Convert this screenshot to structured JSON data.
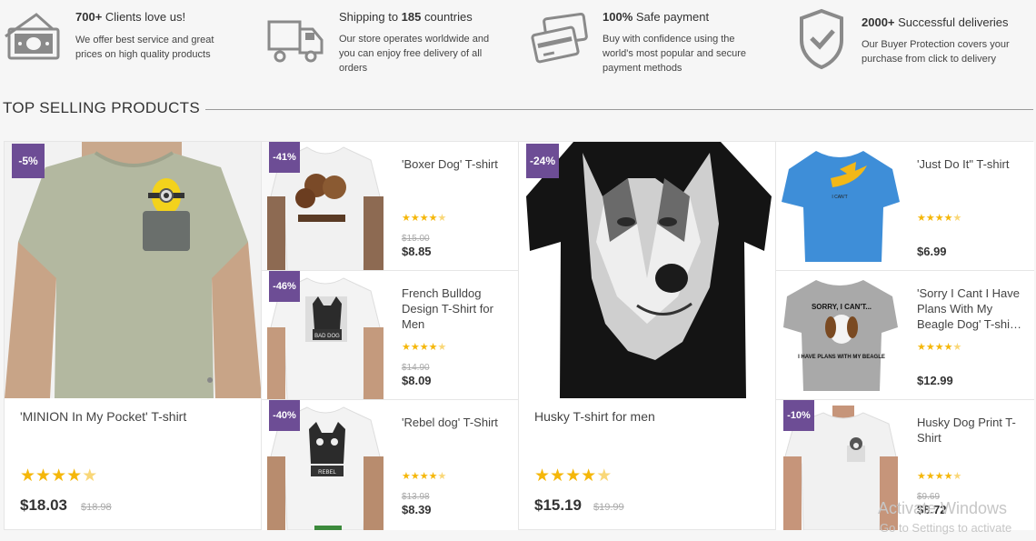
{
  "features": [
    {
      "icon": "money-icon",
      "title_bold": "700+",
      "title_rest": " Clients love us!",
      "desc": "We offer best service and great prices on high quality products"
    },
    {
      "icon": "truck-icon",
      "title_pre": "Shipping to ",
      "title_bold": "185",
      "title_rest": " countries",
      "desc": "Our store operates worldwide and you can enjoy free delivery of all orders"
    },
    {
      "icon": "credit-cards-icon",
      "title_bold": "100%",
      "title_rest": " Safe payment",
      "desc": "Buy with confidence using the world's most popular and secure payment methods"
    },
    {
      "icon": "shield-check-icon",
      "title_bold": "2000+",
      "title_rest": " Successful deliveries",
      "desc": "Our Buyer Protection covers your purchase from click to delivery"
    }
  ],
  "section_title": "TOP SELLING PRODUCTS",
  "products": {
    "minion": {
      "badge": "-5%",
      "name": "'MINION In My Pocket' T-shirt",
      "price": "$18.03",
      "old_price": "$18.98",
      "rating": 4.5,
      "stars": "★★★★★"
    },
    "boxer": {
      "badge": "-41%",
      "name": "'Boxer Dog' T-shirt",
      "price": "$8.85",
      "old_price": "$15.00",
      "rating": 4.5,
      "stars": "★★★★★"
    },
    "bulldog": {
      "badge": "-46%",
      "name": "French Bulldog Design T-Shirt for Men",
      "price": "$8.09",
      "old_price": "$14.90",
      "rating": 4.5,
      "stars": "★★★★★"
    },
    "rebel": {
      "badge": "-40%",
      "name": "'Rebel dog' T-Shirt",
      "price": "$8.39",
      "old_price": "$13.98",
      "rating": 4.5,
      "stars": "★★★★★"
    },
    "husky": {
      "badge": "-24%",
      "name": "Husky T-shirt for men",
      "price": "$15.19",
      "old_price": "$19.99",
      "rating": 4.5,
      "stars": "★★★★★"
    },
    "justdoit": {
      "name": "'Just Do It\" T-shirt",
      "price": "$6.99",
      "rating": 4.5,
      "stars": "★★★★★"
    },
    "beagle": {
      "name": "'Sorry I Cant I Have Plans With My Beagle Dog' T-shi…",
      "price": "$12.99",
      "rating": 4.5,
      "stars": "★★★★★"
    },
    "huskyprint": {
      "badge": "-10%",
      "name": "Husky Dog Print T-Shirt",
      "price": "$8.72",
      "old_price": "$9.69",
      "rating": 4.5,
      "stars": "★★★★★"
    }
  },
  "shirt_text": {
    "bulldog": "BAD DOG",
    "rebel": "REBEL",
    "justdoit": "I CAN'T",
    "beagle_top": "SORRY, I CAN'T...",
    "beagle_bottom": "I HAVE PLANS WITH MY BEAGLE"
  },
  "watermark": {
    "line1": "Activate Windows",
    "line2": "Go to Settings to activate"
  },
  "colors": {
    "badge": "#6d4d95",
    "star": "#f5b70a",
    "accent": "#333333"
  }
}
